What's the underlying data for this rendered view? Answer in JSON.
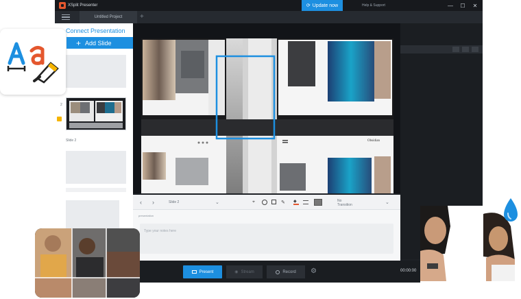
{
  "app": {
    "title": "XSplit Presenter",
    "update_label": "Update now",
    "help_label": "Help & Support",
    "doc_tab": "Untitled Project",
    "win_min": "—",
    "win_max": "☐",
    "win_close": "✕"
  },
  "sidebar": {
    "connect_label": "Connect Presentation",
    "add_slide_label": "Add Slide",
    "slide_number": "2",
    "slide_label": "Slide 2"
  },
  "slide_canvas": {
    "caption": "Obsidian"
  },
  "toolbar": {
    "slide_name": "Slide 2",
    "transition_label": "No\nTransition"
  },
  "notes": {
    "header": "presentation",
    "placeholder": "Type your notes here"
  },
  "bottom": {
    "present_label": "Present",
    "stream_label": "Stream",
    "record_label": "Record",
    "timer": "00:00:00"
  },
  "colors": {
    "accent": "#1d8fe0",
    "app_bg": "#1e2126",
    "titlebar_bg": "#17191d",
    "selection_border": "#1d8fe0"
  },
  "icons": [
    "hamburger-icon",
    "plus-icon",
    "refresh-icon",
    "chevron-left-icon",
    "chevron-right-icon",
    "chevron-down-icon",
    "lasso-icon",
    "circle-icon",
    "square-icon",
    "pen-icon",
    "fill-icon",
    "lines-icon",
    "image-icon",
    "gear-icon",
    "present-icon",
    "stream-icon",
    "record-icon",
    "font-icon",
    "water-drop-icon"
  ]
}
